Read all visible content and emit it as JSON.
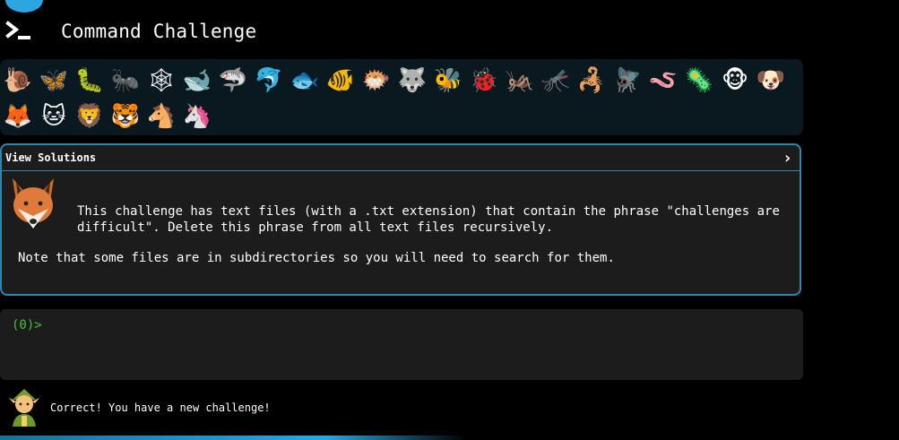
{
  "app": {
    "title": "Command Challenge"
  },
  "animals": [
    {
      "name": "snail",
      "glyph": "🐌"
    },
    {
      "name": "butterfly",
      "glyph": "🦋"
    },
    {
      "name": "caterpillar",
      "glyph": "🐛"
    },
    {
      "name": "ant",
      "glyph": "🐜"
    },
    {
      "name": "spider-web",
      "glyph": "🕸"
    },
    {
      "name": "whale",
      "glyph": "🐋"
    },
    {
      "name": "shark",
      "glyph": "🦈"
    },
    {
      "name": "dolphin",
      "glyph": "🐬"
    },
    {
      "name": "fish",
      "glyph": "🐟"
    },
    {
      "name": "tropical-fish",
      "glyph": "🐠"
    },
    {
      "name": "blowfish",
      "glyph": "🐡"
    },
    {
      "name": "wolf",
      "glyph": "🐺"
    },
    {
      "name": "bee",
      "glyph": "🐝"
    },
    {
      "name": "ladybug",
      "glyph": "🐞"
    },
    {
      "name": "cricket",
      "glyph": "🦗"
    },
    {
      "name": "mosquito",
      "glyph": "🦟"
    },
    {
      "name": "scorpion",
      "glyph": "🦂"
    },
    {
      "name": "fly",
      "glyph": "🪰"
    },
    {
      "name": "worm",
      "glyph": "🪱"
    },
    {
      "name": "microbe",
      "glyph": "🦠"
    },
    {
      "name": "monkey",
      "glyph": "🐵"
    },
    {
      "name": "dog",
      "glyph": "🐶"
    },
    {
      "name": "fox",
      "glyph": "🦊"
    },
    {
      "name": "cat",
      "glyph": "🐱"
    },
    {
      "name": "lion",
      "glyph": "🦁"
    },
    {
      "name": "tiger",
      "glyph": "🐯"
    },
    {
      "name": "horse",
      "glyph": "🐴"
    },
    {
      "name": "unicorn",
      "glyph": "🦄"
    }
  ],
  "challenge": {
    "header": "View Solutions",
    "description": "This challenge has text files (with a .txt extension) that contain the phrase \"challenges are difficult\". Delete this phrase from all text files recursively.",
    "note": "Note that some files are in subdirectories so you will need to search for them."
  },
  "terminal": {
    "prompt": "(0)>"
  },
  "status": {
    "message": "Correct! You have a new challenge!"
  },
  "colors": {
    "accent": "#2e86ad",
    "prompt": "#3ec43e",
    "arc": "#2ba6e0"
  }
}
